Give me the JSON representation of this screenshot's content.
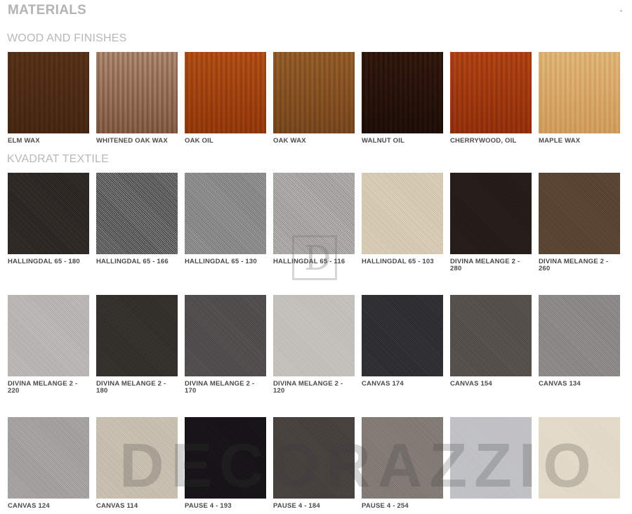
{
  "page": {
    "title": "MATERIALS",
    "watermark": "DECORAZZIO",
    "logo_mark": "D"
  },
  "sections": [
    {
      "title": "WOOD AND FINISHES",
      "rows": [
        [
          {
            "label": "ELM WAX",
            "colors": [
              "#9a7653",
              "#7e5c3e"
            ]
          },
          {
            "label": "WHITENED OAK WAX",
            "colors": [
              "#d9c4b4",
              "#a98873"
            ]
          },
          {
            "label": "OAK OIL",
            "colors": [
              "#d99552",
              "#b86d2c"
            ]
          },
          {
            "label": "OAK WAX",
            "colors": [
              "#c9a06c",
              "#a47d4f"
            ]
          },
          {
            "label": "WALNUT OIL",
            "colors": [
              "#7a5642",
              "#4d3326"
            ]
          },
          {
            "label": "CHERRYWOOD, OIL",
            "colors": [
              "#d98a4e",
              "#b8652e"
            ]
          },
          {
            "label": "MAPLE WAX",
            "colors": [
              "#f1dcb4",
              "#e2c090"
            ]
          }
        ]
      ]
    },
    {
      "title": "KVADRAT TEXTILE",
      "rows": [
        [
          {
            "label": "HALLINGDAL 65 - 180",
            "colors": [
              "#3b3632",
              "#1f1b18"
            ]
          },
          {
            "label": "HALLINGDAL 65 - 166",
            "colors": [
              "#8b8b8b",
              "#3a3a3a"
            ]
          },
          {
            "label": "HALLINGDAL 65 - 130",
            "colors": [
              "#a3a3a3",
              "#707070"
            ]
          },
          {
            "label": "HALLINGDAL 65 - 116",
            "colors": [
              "#c2c0bc",
              "#8d8b87"
            ]
          },
          {
            "label": "HALLINGDAL 65 - 103",
            "colors": [
              "#e3d8c4",
              "#c8baa1"
            ]
          },
          {
            "label": "DIVINA MELANGE 2 - 280",
            "colors": [
              "#2e2520",
              "#1d1512"
            ]
          },
          {
            "label": "DIVINA MELANGE 2 - 260",
            "colors": [
              "#66503f",
              "#4a3829"
            ]
          }
        ],
        [
          {
            "label": "DIVINA MELANGE 2 - 220",
            "colors": [
              "#c6c3c0",
              "#a9a6a3"
            ]
          },
          {
            "label": "DIVINA MELANGE 2 - 180",
            "colors": [
              "#3d3935",
              "#2a2623"
            ]
          },
          {
            "label": "DIVINA MELANGE 2 - 170",
            "colors": [
              "#5d5b5a",
              "#434140"
            ]
          },
          {
            "label": "DIVINA MELANGE 2 - 120",
            "colors": [
              "#cfccc8",
              "#b6b2ae"
            ]
          },
          {
            "label": "CANVAS 174",
            "colors": [
              "#3b3a3d",
              "#232226"
            ]
          },
          {
            "label": "CANVAS 154",
            "colors": [
              "#615a55",
              "#4a4440"
            ]
          },
          {
            "label": "CANVAS 134",
            "colors": [
              "#9a9896",
              "#7b7977"
            ]
          }
        ],
        [
          {
            "label": "CANVAS 124",
            "colors": [
              "#b1afad",
              "#959391"
            ]
          },
          {
            "label": "CANVAS 114",
            "colors": [
              "#d3cbbd",
              "#b9b09f"
            ]
          },
          {
            "label": "PAUSE 4 - 193",
            "colors": [
              "#1f1c1f",
              "#0f0d0f"
            ]
          },
          {
            "label": "PAUSE 4 - 184",
            "colors": [
              "#514b48",
              "#3d3835"
            ]
          },
          {
            "label": "PAUSE 4 - 254",
            "colors": [
              "#8e8680",
              "#766e68"
            ]
          },
          {
            "label": "",
            "colors": [
              "#c7c8cb",
              "#b9babd"
            ]
          },
          {
            "label": "",
            "colors": [
              "#e8e0d0",
              "#dcd2bf"
            ]
          }
        ]
      ]
    }
  ]
}
